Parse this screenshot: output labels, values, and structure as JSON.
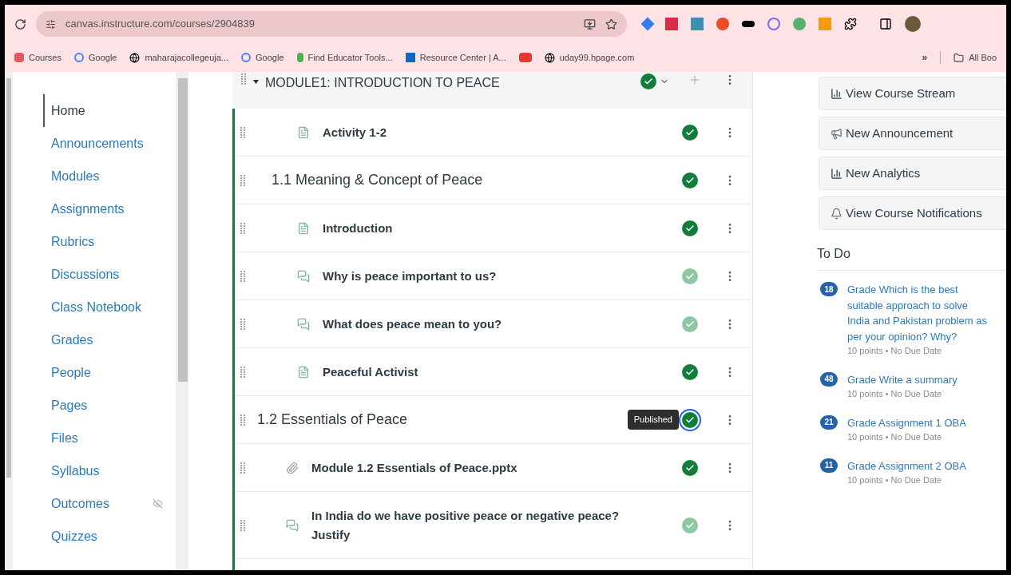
{
  "browser": {
    "url": "canvas.instructure.com/courses/2904839",
    "bookmarks": [
      {
        "label": "Courses",
        "kind": "canvas"
      },
      {
        "label": "Google",
        "kind": "google"
      },
      {
        "label": "maharajacollegeuja...",
        "kind": "globe"
      },
      {
        "label": "Google",
        "kind": "google"
      },
      {
        "label": "Find Educator Tools...",
        "kind": "leaf"
      },
      {
        "label": "Resource Center | A...",
        "kind": "resource"
      },
      {
        "kind": "youtube"
      },
      {
        "label": "uday99.hpage.com",
        "kind": "globe"
      }
    ],
    "more": "»",
    "all_bookmarks": "All Boo"
  },
  "sidebar": {
    "items": [
      {
        "label": "Home",
        "selected": true,
        "hidden": false
      },
      {
        "label": "Announcements",
        "selected": false,
        "hidden": false
      },
      {
        "label": "Modules",
        "selected": false,
        "hidden": false
      },
      {
        "label": "Assignments",
        "selected": false,
        "hidden": false
      },
      {
        "label": "Rubrics",
        "selected": false,
        "hidden": false
      },
      {
        "label": "Discussions",
        "selected": false,
        "hidden": false
      },
      {
        "label": "Class Notebook",
        "selected": false,
        "hidden": false
      },
      {
        "label": "Grades",
        "selected": false,
        "hidden": false
      },
      {
        "label": "People",
        "selected": false,
        "hidden": false
      },
      {
        "label": "Pages",
        "selected": false,
        "hidden": false
      },
      {
        "label": "Files",
        "selected": false,
        "hidden": false
      },
      {
        "label": "Syllabus",
        "selected": false,
        "hidden": false
      },
      {
        "label": "Outcomes",
        "selected": false,
        "hidden": true
      },
      {
        "label": "Quizzes",
        "selected": false,
        "hidden": false
      }
    ]
  },
  "module": {
    "title": "MODULE1: INTRODUCTION TO PEACE",
    "expanded": true,
    "published": true,
    "items": [
      {
        "kind": "page",
        "title": "Activity 1-2",
        "published": true
      },
      {
        "kind": "header",
        "title": "1.1 Meaning & Concept of Peace",
        "published": true
      },
      {
        "kind": "page",
        "title": "Introduction",
        "published": true
      },
      {
        "kind": "discussion",
        "title": "Why is peace important to us?",
        "published": false
      },
      {
        "kind": "discussion",
        "title": "What does peace mean to you?",
        "published": false
      },
      {
        "kind": "page",
        "title": "Peaceful Activist",
        "published": true
      },
      {
        "kind": "header",
        "title": "1.2 Essentials of Peace",
        "published": true,
        "tooltip": "Published"
      },
      {
        "kind": "attachment",
        "title": "Module 1.2 Essentials of Peace.pptx",
        "published": true
      },
      {
        "kind": "discussion",
        "title": "In India do we have positive peace or negative peace? Justify",
        "published": false
      }
    ]
  },
  "actions": [
    {
      "label": "View Course Stream",
      "kind": "chart"
    },
    {
      "label": "New Announcement",
      "kind": "megaphone"
    },
    {
      "label": "New Analytics",
      "kind": "chart"
    },
    {
      "label": "View Course Notifications",
      "kind": "bell"
    }
  ],
  "todo": {
    "title": "To Do",
    "items": [
      {
        "count": "18",
        "title": "Grade Which is the best suitable approach to solve India and Pakistan problem as per your opinion? Why?",
        "meta": "10 points • No Due Date"
      },
      {
        "count": "48",
        "title": "Grade Write a summary",
        "meta": "10 points • No Due Date"
      },
      {
        "count": "21",
        "title": "Grade Assignment 1 OBA",
        "meta": "10 points • No Due Date"
      },
      {
        "count": "11",
        "title": "Grade Assignment 2 OBA",
        "meta": "10 points • No Due Date"
      }
    ]
  }
}
